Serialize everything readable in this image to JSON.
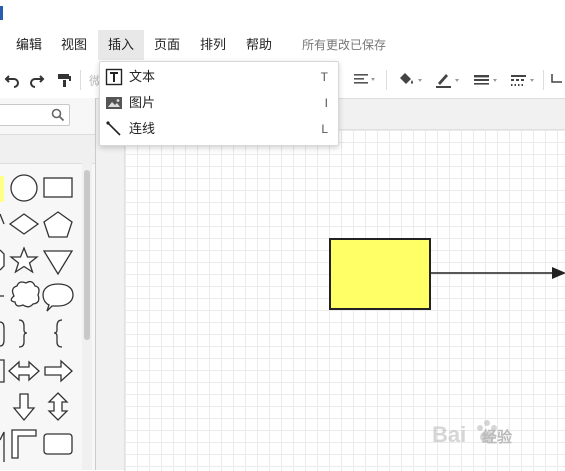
{
  "menubar": {
    "items": [
      "编辑",
      "视图",
      "插入",
      "页面",
      "排列",
      "帮助"
    ],
    "active": "插入",
    "save_status": "所有更改已保存"
  },
  "insert_menu": {
    "items": [
      {
        "label": "文本",
        "shortcut": "T",
        "icon": "text-icon"
      },
      {
        "label": "图片",
        "shortcut": "I",
        "icon": "image-icon"
      },
      {
        "label": "连线",
        "shortcut": "L",
        "icon": "line-icon"
      }
    ]
  },
  "toolbar": {
    "hidden_label": "微",
    "icons": [
      "undo-icon",
      "redo-icon",
      "format-painter-icon",
      "align-icon",
      "fill-color-icon",
      "line-color-icon",
      "line-width-icon",
      "line-style-icon",
      "connector-icon"
    ]
  },
  "canvas": {
    "shape_fill": "#ffff66",
    "shape_stroke": "#222222",
    "shape": "rectangle",
    "connector": "arrow"
  },
  "watermark": {
    "brand": "Bai",
    "label": "经验"
  }
}
